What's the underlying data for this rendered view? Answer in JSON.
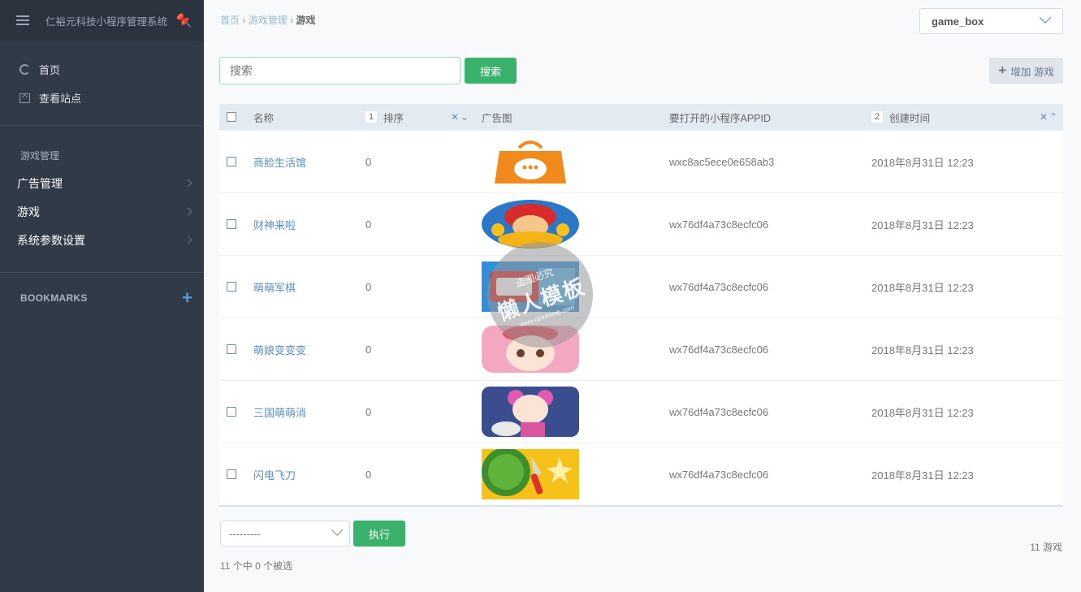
{
  "sidebar": {
    "title": "仁裕元科技小程序管理系统",
    "links": [
      {
        "label": "首页",
        "icon": "home-icon"
      },
      {
        "label": "查看站点",
        "icon": "view-site-icon"
      }
    ],
    "section_title": "游戏管理",
    "menu": [
      {
        "label": "广告管理"
      },
      {
        "label": "游戏"
      },
      {
        "label": "系统参数设置"
      }
    ],
    "bookmarks_label": "BOOKMARKS"
  },
  "breadcrumb": {
    "home": "首页",
    "app": "游戏管理",
    "current": "游戏",
    "separator": "›"
  },
  "app_select": {
    "value": "game_box"
  },
  "search": {
    "placeholder": "搜索",
    "button_label": "搜索"
  },
  "add_button_label": "增加 游戏",
  "table": {
    "columns": {
      "name": "名称",
      "order": "排序",
      "order_sort_index": "1",
      "ad_image": "广告图",
      "appid": "要打开的小程序APPID",
      "created": "创建时间",
      "created_sort_index": "2"
    },
    "rows": [
      {
        "name": "商脸生活馆",
        "order": "0",
        "appid": "wxc8ac5ece0e658ab3",
        "created": "2018年8月31日 12:23",
        "image": "shopping-bag-image"
      },
      {
        "name": "财神来啦",
        "order": "0",
        "appid": "wx76df4a73c8ecfc06",
        "created": "2018年8月31日 12:23",
        "image": "fortune-god-image"
      },
      {
        "name": "萌萌军棋",
        "order": "0",
        "appid": "wx76df4a73c8ecfc06",
        "created": "2018年8月31日 12:23",
        "image": "army-chess-image"
      },
      {
        "name": "萌娘变变变",
        "order": "0",
        "appid": "wx76df4a73c8ecfc06",
        "created": "2018年8月31日 12:23",
        "image": "anime-girl-image"
      },
      {
        "name": "三国萌萌消",
        "order": "0",
        "appid": "wx76df4a73c8ecfc06",
        "created": "2018年8月31日 12:23",
        "image": "three-kingdoms-image"
      },
      {
        "name": "闪电飞刀",
        "order": "0",
        "appid": "wx76df4a73c8ecfc06",
        "created": "2018年8月31日 12:23",
        "image": "watermelon-knife-image"
      }
    ]
  },
  "footer": {
    "action_select_value": "---------",
    "run_button_label": "执行",
    "selected_text": "11 个中 0 个被选",
    "total_text": "11 游戏"
  },
  "watermark": {
    "top": "盗图必究",
    "main": "懒人模板",
    "url": "www.lanrenmb.com"
  },
  "colors": {
    "sidebar_bg": "#313a47",
    "accent_green": "#3bb26c",
    "link_blue": "#5b8fc0",
    "header_bg": "#e2eaf2"
  }
}
